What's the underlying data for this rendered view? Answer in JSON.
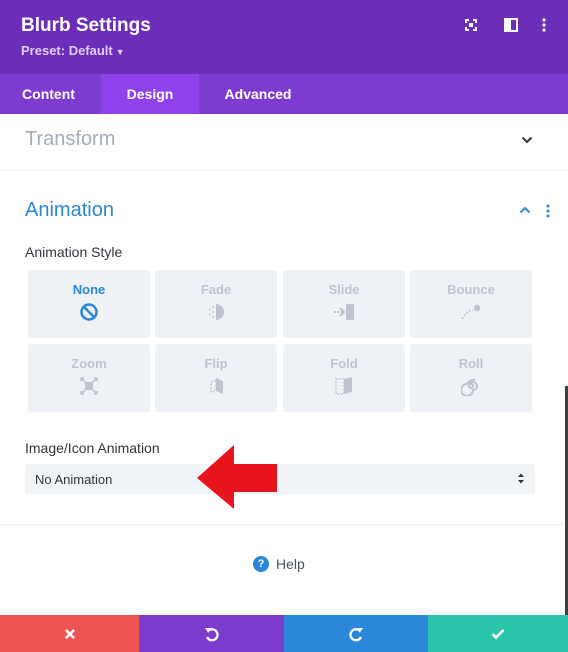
{
  "header": {
    "title": "Blurb Settings",
    "preset": "Preset: Default",
    "icons": [
      "expand-icon",
      "sidebar-icon",
      "more-vertical-icon"
    ],
    "background": "#6c2eb9"
  },
  "tabs": [
    {
      "label": "Content",
      "active": false
    },
    {
      "label": "Design",
      "active": true
    },
    {
      "label": "Advanced",
      "active": false
    }
  ],
  "sections": {
    "transform": {
      "title": "Transform",
      "expanded": false
    },
    "animation": {
      "title": "Animation",
      "expanded": true
    }
  },
  "animation_style": {
    "label": "Animation Style",
    "options": [
      {
        "label": "None",
        "icon": "ban-icon",
        "selected": true
      },
      {
        "label": "Fade",
        "icon": "fade-icon",
        "selected": false
      },
      {
        "label": "Slide",
        "icon": "slide-icon",
        "selected": false
      },
      {
        "label": "Bounce",
        "icon": "bounce-icon",
        "selected": false
      },
      {
        "label": "Zoom",
        "icon": "zoom-icon",
        "selected": false
      },
      {
        "label": "Flip",
        "icon": "flip-icon",
        "selected": false
      },
      {
        "label": "Fold",
        "icon": "fold-icon",
        "selected": false
      },
      {
        "label": "Roll",
        "icon": "roll-icon",
        "selected": false
      }
    ]
  },
  "image_icon_animation": {
    "label": "Image/Icon Animation",
    "value": "No Animation"
  },
  "help": {
    "label": "Help",
    "icon": "question-icon"
  },
  "footer": {
    "buttons": [
      {
        "name": "discard",
        "icon": "close-icon",
        "color": "#ef5555"
      },
      {
        "name": "undo",
        "icon": "undo-icon",
        "color": "#7e3bd0"
      },
      {
        "name": "redo",
        "icon": "redo-icon",
        "color": "#2b87da"
      },
      {
        "name": "save",
        "icon": "check-icon",
        "color": "#29c4a9"
      }
    ]
  },
  "colors": {
    "accent": "#2b87da",
    "tab_active": "#8f42ec",
    "tabs_bar": "#7d3bcf",
    "annotation_arrow": "#e8141b"
  }
}
